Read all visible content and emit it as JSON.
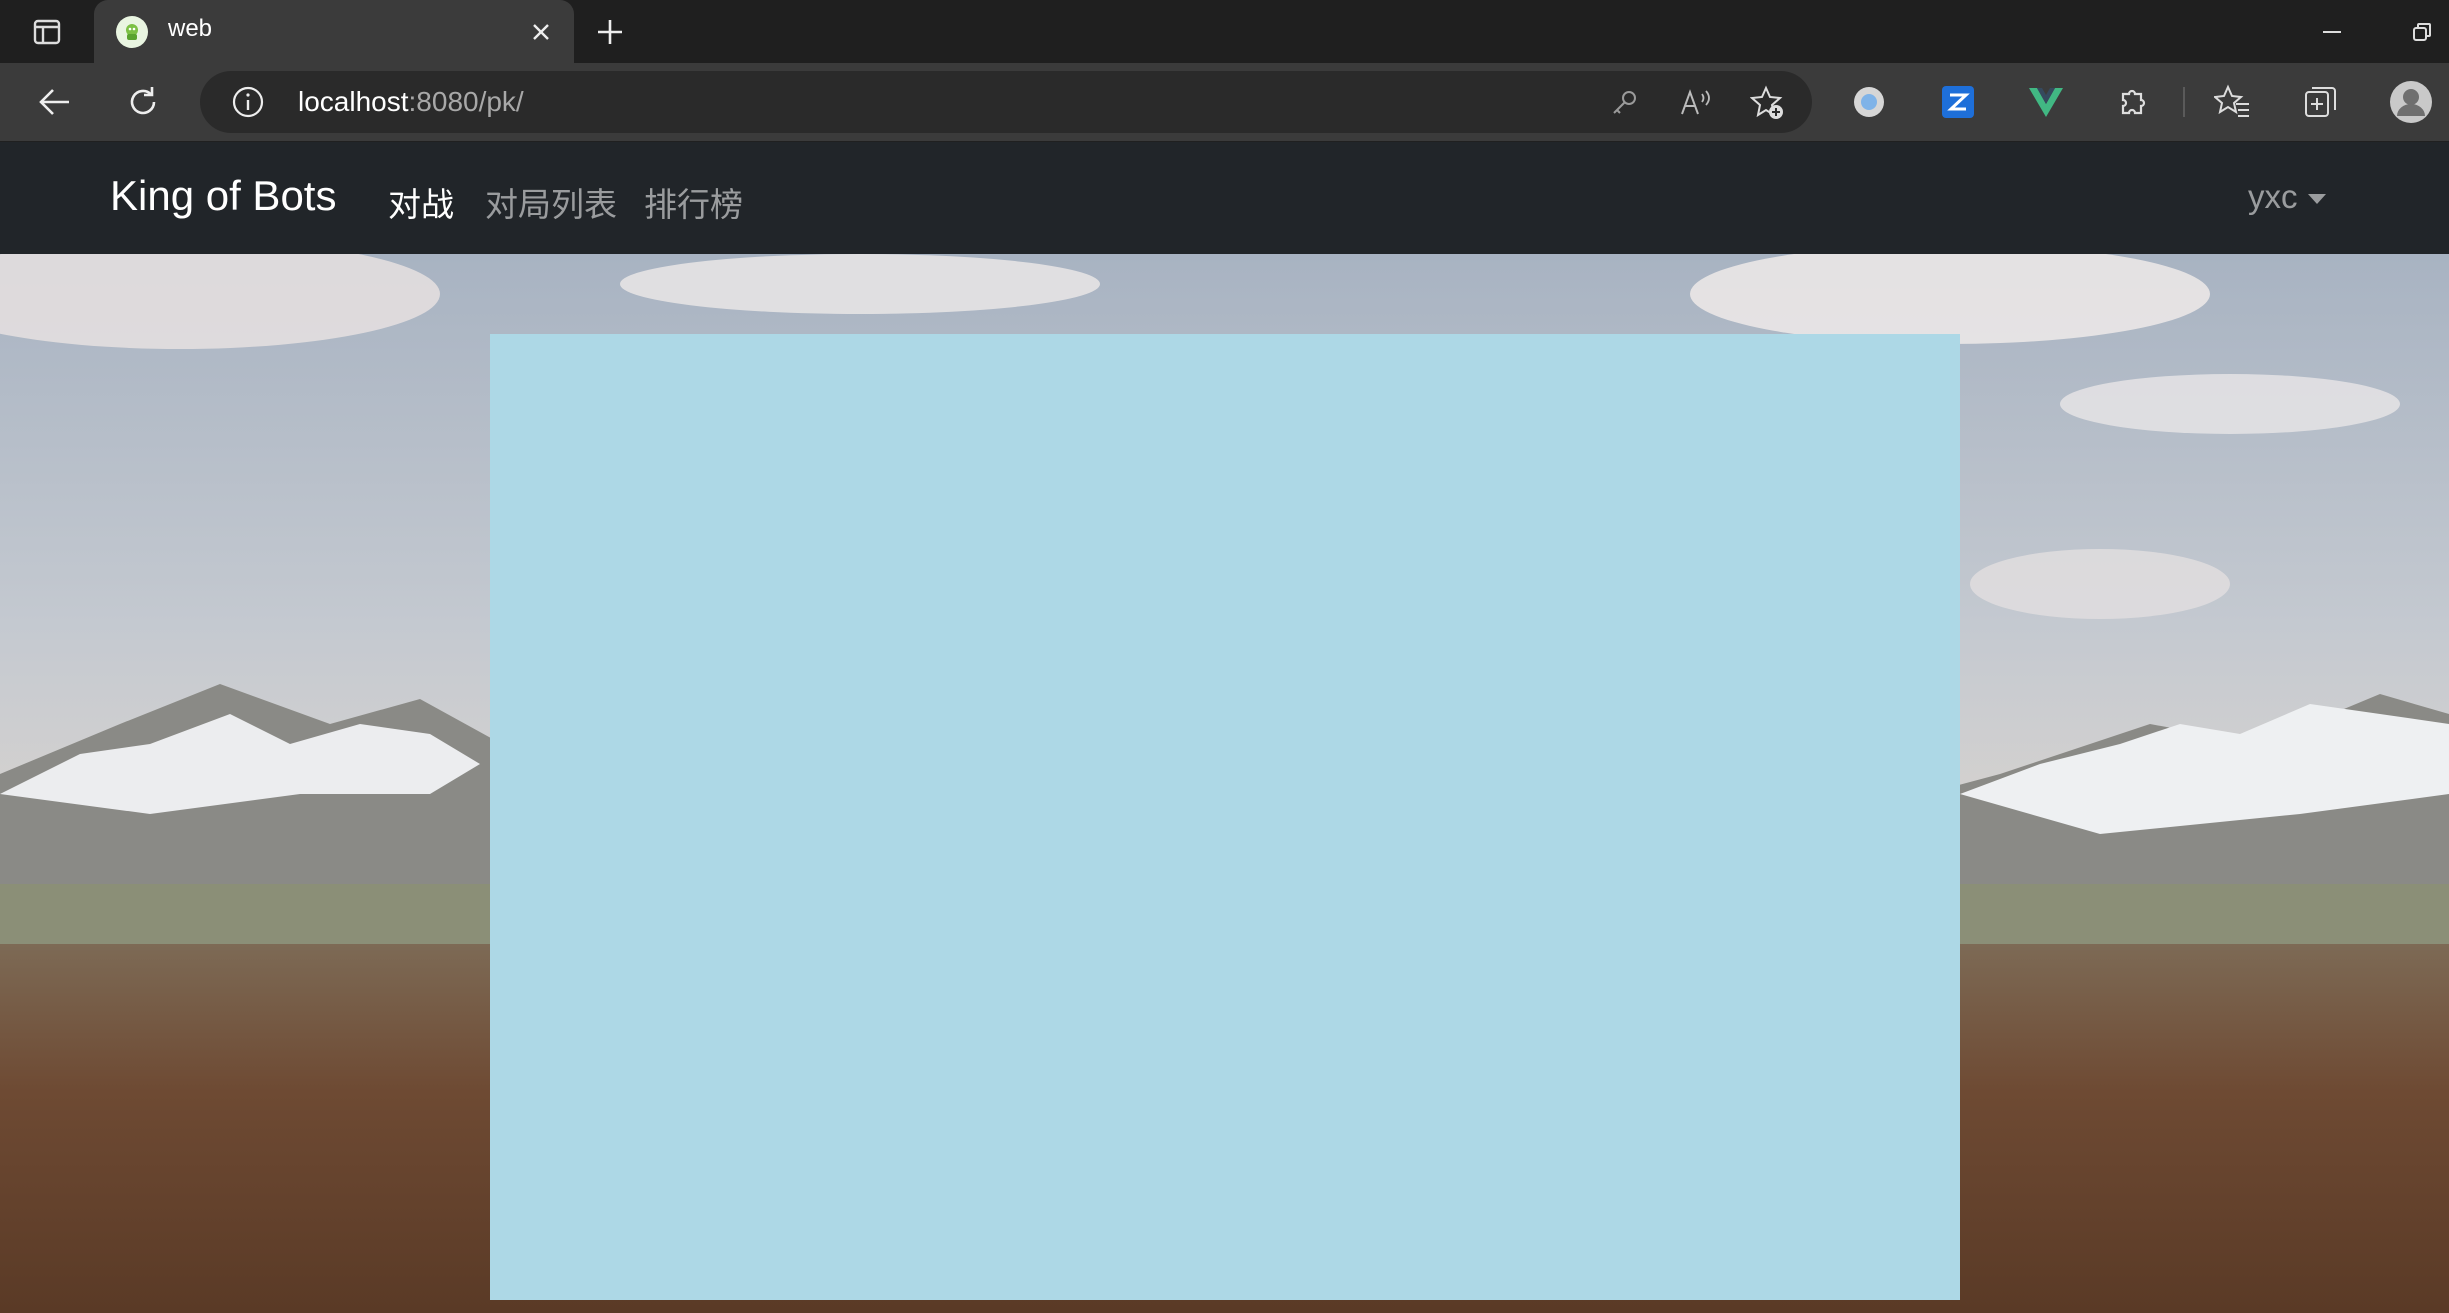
{
  "browser": {
    "tab": {
      "title": "web",
      "favicon": "robot-favicon"
    },
    "url": {
      "host": "localhost",
      "rest": ":8080/pk/"
    },
    "icons": {
      "tab_actions": "tab-actions-icon",
      "close_tab": "close-icon",
      "new_tab": "plus-icon",
      "minimize": "minimize-icon",
      "restore": "restore-icon",
      "back": "back-arrow-icon",
      "refresh": "refresh-icon",
      "site_info": "info-icon",
      "password": "key-icon",
      "read_aloud": "read-aloud-icon",
      "add_favorite": "add-favorite-icon",
      "extension1": "circle-extension-icon",
      "extension2": "z-extension-icon",
      "extension3": "vue-devtools-icon",
      "extensions": "puzzle-icon",
      "favorites": "favorites-icon",
      "collections": "collections-icon",
      "profile": "profile-icon"
    }
  },
  "navbar": {
    "brand": "King of Bots",
    "links": [
      {
        "label": "对战",
        "active": true
      },
      {
        "label": "对局列表",
        "active": false
      },
      {
        "label": "排行榜",
        "active": false
      }
    ],
    "user": "yxc"
  },
  "playground": {
    "color": "#add8e6"
  },
  "colors": {
    "navbar_bg": "#212529",
    "chrome_bg": "#1f1f1f",
    "toolbar_bg": "#3b3b3b"
  }
}
